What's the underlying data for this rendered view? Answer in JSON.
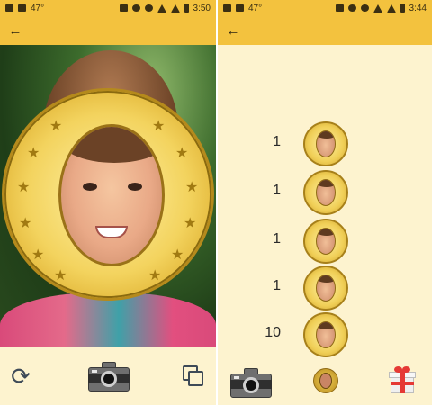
{
  "left_screen": {
    "status": {
      "time": "3:50",
      "temperature": "47°"
    },
    "toolbar": {
      "refresh_icon": "refresh-icon",
      "camera_icon": "camera-icon",
      "copy_icon": "copy-icon"
    }
  },
  "right_screen": {
    "status": {
      "time": "3:44",
      "temperature": "47°"
    },
    "coins": [
      {
        "count": "1"
      },
      {
        "count": "1"
      },
      {
        "count": "1"
      },
      {
        "count": "1"
      },
      {
        "count": "10"
      }
    ],
    "toolbar": {
      "camera_icon": "camera-icon",
      "face_coin_icon": "face-coin-icon",
      "gift_icon": "gift-icon"
    }
  },
  "colors": {
    "header": "#f3c23e",
    "panel": "#fdf3cf",
    "coin_gold": "#f0cf57"
  }
}
